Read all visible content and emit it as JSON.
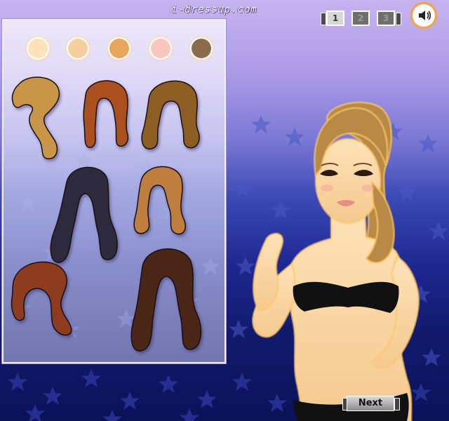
{
  "site": {
    "title": "i-dressup.com"
  },
  "skin_tones": [
    {
      "name": "fair",
      "color": "#fde3b8"
    },
    {
      "name": "light",
      "color": "#f5cf9d"
    },
    {
      "name": "tan",
      "color": "#e8a65c"
    },
    {
      "name": "rosy",
      "color": "#f9c7bd"
    },
    {
      "name": "brown",
      "color": "#8b6a4e"
    }
  ],
  "hairstyles": [
    {
      "name": "short-blonde-sideswept",
      "color": "#c99548"
    },
    {
      "name": "auburn-wavy",
      "color": "#a9501e"
    },
    {
      "name": "brown-curly",
      "color": "#8c5e24"
    },
    {
      "name": "black-long-curly",
      "color": "#2c2a3c"
    },
    {
      "name": "light-brown-bob",
      "color": "#c07e3e"
    },
    {
      "name": "red-brown-side",
      "color": "#8e3c20"
    },
    {
      "name": "dark-brown-long-wavy",
      "color": "#4a2616"
    }
  ],
  "level_nav": {
    "levels": [
      "1",
      "2",
      "3"
    ],
    "active": "1"
  },
  "next_button": {
    "label": "Next"
  },
  "model": {
    "hair_color": "#b98a45",
    "top_color": "#111111"
  }
}
